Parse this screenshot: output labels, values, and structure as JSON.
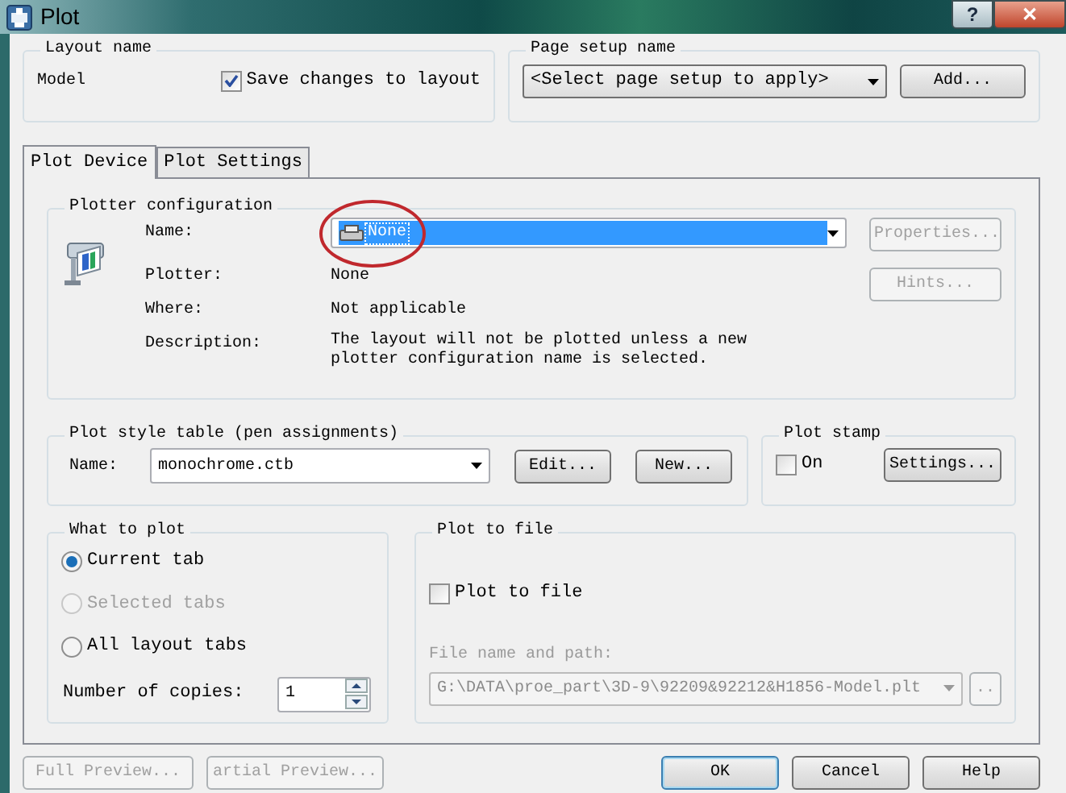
{
  "window": {
    "title": "Plot",
    "title_buttons": [
      "?",
      "✕"
    ]
  },
  "layout_name": {
    "label": "Layout name",
    "value": "Model",
    "save_changes": {
      "label": "Save changes to layout",
      "checked": true
    }
  },
  "page_setup": {
    "label": "Page setup name",
    "value": "<Select page setup to apply>",
    "add_button": "Add..."
  },
  "tabs": [
    {
      "label": "Plot Device",
      "selected": true
    },
    {
      "label": "Plot Settings",
      "selected": false
    }
  ],
  "plotter_configuration": {
    "label": "Plotter configuration",
    "name_label": "Name:",
    "name_value": "None",
    "circled": true,
    "fields": [
      {
        "label": "Plotter:",
        "value": "None"
      },
      {
        "label": "Where:",
        "value": "Not applicable"
      },
      {
        "label": "Description:",
        "value": "The layout will not be plotted unless a new plotter configuration name is selected."
      }
    ],
    "buttons": [
      {
        "label": "Properties...",
        "disabled": true
      },
      {
        "label": "Hints...",
        "disabled": true
      }
    ]
  },
  "plot_style_table": {
    "label": "Plot style table (pen assignments)",
    "name_label": "Name:",
    "value": "monochrome.ctb",
    "buttons": [
      "Edit...",
      "New..."
    ]
  },
  "plot_stamp": {
    "label": "Plot stamp",
    "on": {
      "label": "On",
      "checked": false
    },
    "settings_button": "Settings..."
  },
  "what_to_plot": {
    "label": "What to plot",
    "options": [
      {
        "label": "Current tab",
        "selected": true,
        "disabled": false
      },
      {
        "label": "Selected tabs",
        "selected": false,
        "disabled": true
      },
      {
        "label": "All layout tabs",
        "selected": false,
        "disabled": false
      }
    ],
    "copies_label": "Number of copies:",
    "copies": "1"
  },
  "plot_to_file": {
    "label": "Plot to file",
    "checkbox": {
      "label": "Plot to file",
      "checked": false
    },
    "path_label": "File name and path:",
    "path": "G:\\DATA\\proe_part\\3D-9\\92209&92212&H1856-Model.plt",
    "browse_button": "..",
    "disabled": true
  },
  "footer_left": [
    {
      "label": "Full Preview...",
      "disabled": true
    },
    {
      "label": "artial Preview...",
      "disabled": true
    }
  ],
  "footer_right": [
    {
      "label": "OK",
      "default": true
    },
    {
      "label": "Cancel",
      "default": false
    },
    {
      "label": "Help",
      "default": false
    }
  ]
}
